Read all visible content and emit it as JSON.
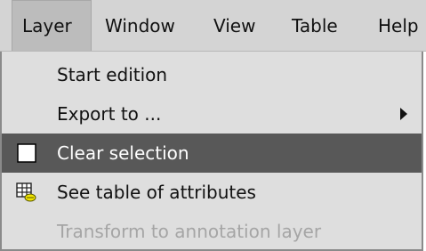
{
  "menubar": {
    "items": [
      {
        "label": "Layer"
      },
      {
        "label": "Window"
      },
      {
        "label": "View"
      },
      {
        "label": "Table"
      },
      {
        "label": "Help"
      }
    ]
  },
  "layer_menu": {
    "items": [
      {
        "label": "Start edition",
        "enabled": true
      },
      {
        "label": "Export to ...",
        "enabled": true,
        "has_submenu": true
      },
      {
        "label": "Clear selection",
        "enabled": true,
        "highlighted": true,
        "icon": "blank-selection-icon"
      },
      {
        "label": "See table of attributes",
        "enabled": true,
        "icon": "attribute-table-icon"
      },
      {
        "label": "Transform to annotation layer",
        "enabled": false
      }
    ]
  },
  "colors": {
    "highlight": "#585858",
    "disabled_text": "#a5a5a5"
  }
}
